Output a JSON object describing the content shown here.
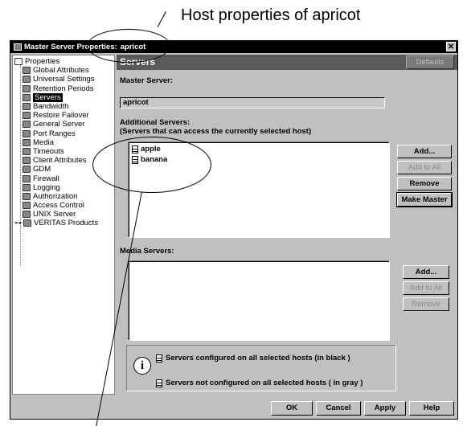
{
  "annotation": {
    "text": "Host properties of apricot"
  },
  "window": {
    "title": "Master Server Properties:",
    "host": "apricot",
    "close_glyph": "✕"
  },
  "tree": {
    "items": [
      {
        "label": "Properties",
        "icon": "properties-icon",
        "root": true
      },
      {
        "label": "Global Attributes",
        "icon": "globe-icon"
      },
      {
        "label": "Universal Settings",
        "icon": "settings-icon"
      },
      {
        "label": "Retention Periods",
        "icon": "retention-icon"
      },
      {
        "label": "Servers",
        "icon": "server-icon",
        "selected": true
      },
      {
        "label": "Bandwidth",
        "icon": "bandwidth-icon"
      },
      {
        "label": "Restore Failover",
        "icon": "failover-icon"
      },
      {
        "label": "General Server",
        "icon": "server-icon"
      },
      {
        "label": "Port Ranges",
        "icon": "port-icon"
      },
      {
        "label": "Media",
        "icon": "media-icon"
      },
      {
        "label": "Timeouts",
        "icon": "clock-icon"
      },
      {
        "label": "Client Attributes",
        "icon": "client-icon"
      },
      {
        "label": "GDM",
        "icon": "gdm-icon"
      },
      {
        "label": "Firewall",
        "icon": "firewall-icon"
      },
      {
        "label": "Logging",
        "icon": "logging-icon"
      },
      {
        "label": "Authorization",
        "icon": "authorization-icon"
      },
      {
        "label": "Access Control",
        "icon": "access-control-icon"
      },
      {
        "label": "UNIX Server",
        "icon": "unix-server-icon"
      },
      {
        "label": "VERITAS Products",
        "icon": "products-icon",
        "expander": "⊶"
      }
    ]
  },
  "main": {
    "header_title": "Servers",
    "defaults_label": "Defaults",
    "master_server_label": "Master Server:",
    "master_server_value": "apricot",
    "additional_label": "Additional Servers:",
    "additional_sublabel": "(Servers that can access the currently selected host)",
    "additional_servers": [
      "apple",
      "banana"
    ],
    "additional_buttons": {
      "add": "Add...",
      "add_to_all": "Add to All",
      "remove": "Remove",
      "make_master": "Make Master"
    },
    "media_label": "Media Servers:",
    "media_buttons": {
      "add": "Add...",
      "add_to_all": "Add to All",
      "remove": "Remove"
    },
    "legend": {
      "info_glyph": "i",
      "configured": "Servers configured on all selected hosts (in black )",
      "not_configured": "Servers not configured on all selected hosts ( in gray )"
    }
  },
  "footer": {
    "ok": "OK",
    "cancel": "Cancel",
    "apply": "Apply",
    "help": "Help"
  }
}
